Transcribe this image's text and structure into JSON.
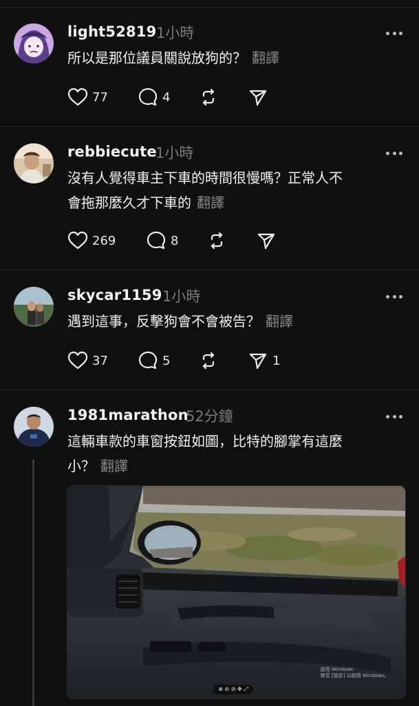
{
  "posts": [
    {
      "username": "light52819",
      "time": "1小時",
      "text": "所以是那位議員關說放狗的？",
      "translate": "翻譯",
      "likes": "77",
      "comments": "4",
      "reposts": "",
      "shares": ""
    },
    {
      "username": "rebbiecute",
      "time": "1小時",
      "text_line1": "沒有人覺得車主下車的時間很慢嗎？正常人不",
      "text_line2": "會拖那麼久才下車的",
      "translate": "翻譯",
      "likes": "269",
      "comments": "8",
      "reposts": "",
      "shares": ""
    },
    {
      "username": "skycar1159",
      "time": "1小時",
      "text": "遇到這事，反擊狗會不會被告？",
      "translate": "翻譯",
      "likes": "37",
      "comments": "5",
      "reposts": "",
      "shares": "1"
    },
    {
      "username": "1981marathon",
      "time": "52分鐘",
      "text_line1": "這輛車款的車窗按鈕如圖，比特的腳掌有這麼",
      "text_line2": "小？",
      "translate": "翻譯",
      "image_watermark_line1": "啟用 Windows",
      "image_watermark_line2": "移至 [設定] 以啟用 Windows。",
      "image_toolbar": "⊕ ⊖ ⊘   ✥ ⤢"
    }
  ],
  "icons": [
    "heart-icon",
    "comment-icon",
    "repost-icon",
    "share-icon",
    "more-icon"
  ],
  "colors": {
    "background": "#101010",
    "text": "#f3f3f3",
    "muted": "#7a7a7a",
    "divider": "#262626"
  }
}
